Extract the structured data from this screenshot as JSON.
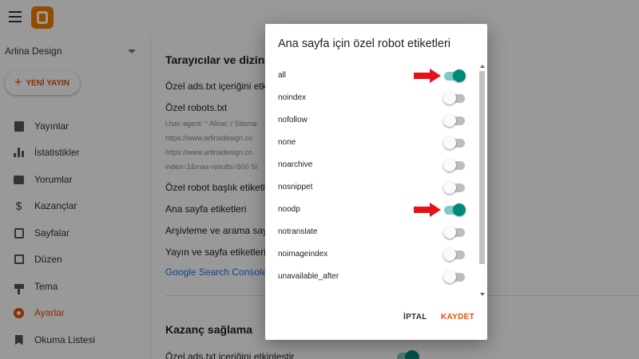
{
  "app": {
    "blog_name": "Arlina Design",
    "new_post_label": "YENİ YAYIN"
  },
  "sidebar": {
    "items": [
      {
        "label": "Yayınlar",
        "icon": "posts-icon"
      },
      {
        "label": "İstatistikler",
        "icon": "stats-icon"
      },
      {
        "label": "Yorumlar",
        "icon": "comments-icon"
      },
      {
        "label": "Kazançlar",
        "icon": "earnings-icon"
      },
      {
        "label": "Sayfalar",
        "icon": "pages-icon"
      },
      {
        "label": "Düzen",
        "icon": "layout-icon"
      },
      {
        "label": "Tema",
        "icon": "theme-icon"
      },
      {
        "label": "Ayarlar",
        "icon": "settings-icon",
        "active": true
      },
      {
        "label": "Okuma Listesi",
        "icon": "reading-list-icon"
      }
    ]
  },
  "main": {
    "section_crawlers": "Tarayıcılar ve dizine e",
    "ads_txt_label": "Özel ads.txt içeriğini etkin",
    "robots_txt_label": "Özel robots.txt",
    "robots_lines": [
      "User-agent: * Allow: / Sitema",
      "https://www.arlinadesign.co",
      "https://www.arlinadesign.co",
      "index=1&max-results=500 Si"
    ],
    "robot_header_label": "Özel robot başlık etiketler",
    "homepage_tags_label": "Ana sayfa etiketleri",
    "archive_tags_label": "Arşivleme ve arama sayfa",
    "post_tags_label": "Yayın ve sayfa etiketleri",
    "search_console_link": "Google Search Console",
    "section_monetization": "Kazanç sağlama",
    "monetization_ads_label": "Özel ads.txt içeriğini etkinleştir"
  },
  "dialog": {
    "title": "Ana sayfa için özel robot etiketleri",
    "options": [
      {
        "label": "all",
        "on": true,
        "arrow": true
      },
      {
        "label": "noindex",
        "on": false
      },
      {
        "label": "nofollow",
        "on": false
      },
      {
        "label": "none",
        "on": false
      },
      {
        "label": "noarchive",
        "on": false
      },
      {
        "label": "nosnippet",
        "on": false
      },
      {
        "label": "noodp",
        "on": true,
        "arrow": true
      },
      {
        "label": "notranslate",
        "on": false
      },
      {
        "label": "noimageindex",
        "on": false
      },
      {
        "label": "unavailable_after",
        "on": false
      }
    ],
    "cancel_label": "İPTAL",
    "save_label": "KAYDET"
  },
  "colors": {
    "accent": "#e65100",
    "toggle_on": "#00897b",
    "arrow": "#e5121a"
  }
}
